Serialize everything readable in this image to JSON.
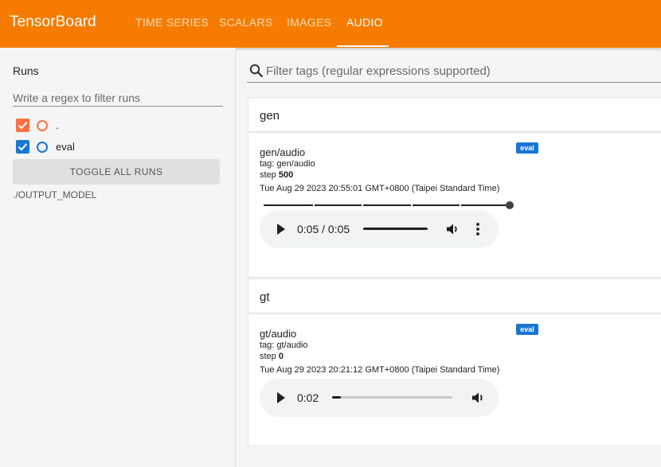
{
  "header": {
    "brand": "TensorBoard",
    "tabs": [
      {
        "label": "TIME SERIES",
        "active": false
      },
      {
        "label": "SCALARS",
        "active": false
      },
      {
        "label": "IMAGES",
        "active": false
      },
      {
        "label": "AUDIO",
        "active": true
      }
    ]
  },
  "sidebar": {
    "title": "Runs",
    "filter_placeholder": "Write a regex to filter runs",
    "runs": [
      {
        "label": ".",
        "checked": true,
        "color": "#ff7043"
      },
      {
        "label": "eval",
        "checked": true,
        "color": "#1976d2"
      }
    ],
    "toggle_label": "TOGGLE ALL RUNS",
    "output_path": "./OUTPUT_MODEL"
  },
  "main": {
    "tag_filter_placeholder": "Filter tags (regular expressions supported)",
    "groups": [
      {
        "name": "gen",
        "card": {
          "title": "gen/audio",
          "run_badge": "eval",
          "tag_line": "tag: gen/audio",
          "step_label": "step",
          "step_value": "500",
          "timestamp": "Tue Aug 29 2023 20:55:01 GMT+0800 (Taipei Standard Time)",
          "step_slider_fraction": 1.0,
          "player": {
            "time_display": "0:05 / 0:05",
            "progress_fraction": 1.0
          }
        }
      },
      {
        "name": "gt",
        "card": {
          "title": "gt/audio",
          "run_badge": "eval",
          "tag_line": "tag: gt/audio",
          "step_label": "step",
          "step_value": "0",
          "timestamp": "Tue Aug 29 2023 20:21:12 GMT+0800 (Taipei Standard Time)",
          "player": {
            "time_display": "0:02",
            "progress_fraction": 0.07
          }
        }
      }
    ]
  },
  "colors": {
    "header": "#f57c00",
    "badge": "#1976d2",
    "run_dot": "#ff7043",
    "run_eval": "#1976d2"
  },
  "icons": [
    "search-icon",
    "checkmark-icon",
    "play-icon",
    "volume-icon",
    "more-vert-icon"
  ]
}
